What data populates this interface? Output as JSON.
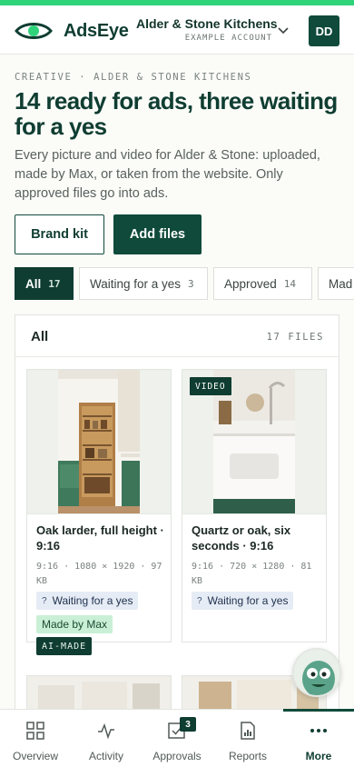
{
  "app": {
    "name": "AdsEye",
    "accent_color": "#2fd37a",
    "brand_color": "#0f4a3a"
  },
  "header": {
    "account_name": "Alder & Stone Kitchens",
    "account_sub": "EXAMPLE ACCOUNT",
    "avatar_initials": "DD",
    "chevron_icon": "chevron-down-icon"
  },
  "page": {
    "eyebrow": "CREATIVE · ALDER & STONE KITCHENS",
    "title": "14 ready for ads, three waiting for a yes",
    "description": "Every picture and video for Alder & Stone: uploaded, made by Max, or taken from the website. Only approved files go into ads."
  },
  "actions": {
    "brand_kit": "Brand kit",
    "add_files": "Add files"
  },
  "tabs": [
    {
      "label": "All",
      "count": "17",
      "active": true
    },
    {
      "label": "Waiting for a yes",
      "count": "3",
      "active": false
    },
    {
      "label": "Approved",
      "count": "14",
      "active": false
    },
    {
      "label": "Mad",
      "count": "",
      "active": false
    }
  ],
  "panel": {
    "title": "All",
    "count": "17 FILES"
  },
  "cards": [
    {
      "title": "Oak larder, full height · 9:16",
      "meta": "9:16 · 1080 × 1920 · 97 KB",
      "status": "Waiting for a yes",
      "status_icon": "?",
      "source": "Made by Max",
      "ai_label": "AI-MADE",
      "media": "kitchen-larder-photo"
    },
    {
      "title": "Quartz or oak, six seconds · 9:16",
      "meta": "9:16 · 720 × 1280 · 81 KB",
      "status": "Waiting for a yes",
      "status_icon": "?",
      "video_tag": "VIDEO",
      "media": "quartz-countertop-video"
    }
  ],
  "bottom_nav": [
    {
      "label": "Overview",
      "icon": "grid-icon"
    },
    {
      "label": "Activity",
      "icon": "activity-icon"
    },
    {
      "label": "Approvals",
      "icon": "checkbox-icon",
      "badge": "3"
    },
    {
      "label": "Reports",
      "icon": "report-icon"
    },
    {
      "label": "More",
      "icon": "more-dots-icon",
      "active": true
    }
  ]
}
